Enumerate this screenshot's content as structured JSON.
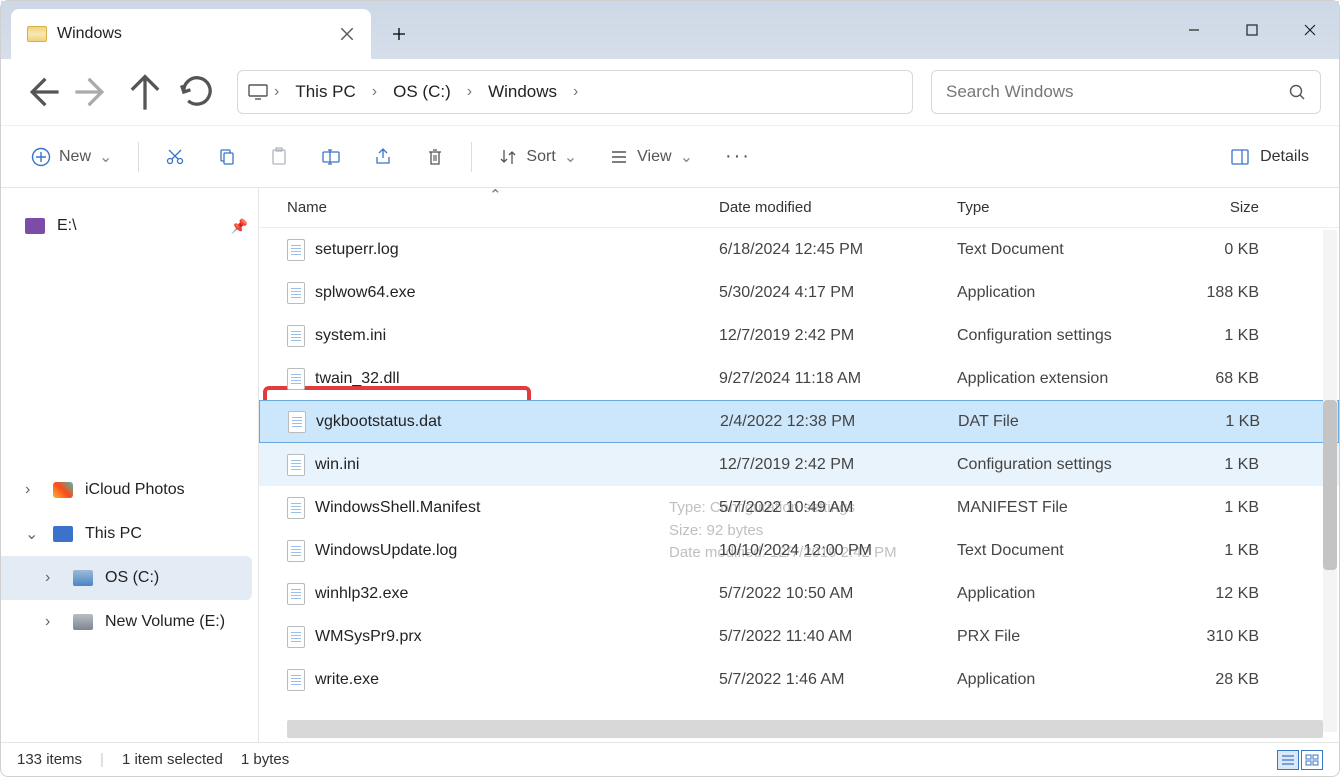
{
  "window": {
    "tab_title": "Windows"
  },
  "breadcrumb": {
    "root": "This PC",
    "seg1": "OS (C:)",
    "seg2": "Windows"
  },
  "search": {
    "placeholder": "Search Windows"
  },
  "toolbar": {
    "new_label": "New",
    "sort_label": "Sort",
    "view_label": "View",
    "details_label": "Details"
  },
  "columns": {
    "name": "Name",
    "modified": "Date modified",
    "type": "Type",
    "size": "Size"
  },
  "sidebar": {
    "item0": "E:\\",
    "item1": "iCloud Photos",
    "item2": "This PC",
    "item3": "OS (C:)",
    "item4": "New Volume (E:)"
  },
  "files": [
    {
      "name": "setuperr.log",
      "date": "6/18/2024 12:45 PM",
      "type": "Text Document",
      "size": "0 KB"
    },
    {
      "name": "splwow64.exe",
      "date": "5/30/2024 4:17 PM",
      "type": "Application",
      "size": "188 KB"
    },
    {
      "name": "system.ini",
      "date": "12/7/2019 2:42 PM",
      "type": "Configuration settings",
      "size": "1 KB"
    },
    {
      "name": "twain_32.dll",
      "date": "9/27/2024 11:18 AM",
      "type": "Application extension",
      "size": "68 KB"
    },
    {
      "name": "vgkbootstatus.dat",
      "date": "2/4/2022 12:38 PM",
      "type": "DAT File",
      "size": "1 KB"
    },
    {
      "name": "win.ini",
      "date": "12/7/2019 2:42 PM",
      "type": "Configuration settings",
      "size": "1 KB"
    },
    {
      "name": "WindowsShell.Manifest",
      "date": "5/7/2022 10:49 AM",
      "type": "MANIFEST File",
      "size": "1 KB"
    },
    {
      "name": "WindowsUpdate.log",
      "date": "10/10/2024 12:00 PM",
      "type": "Text Document",
      "size": "1 KB"
    },
    {
      "name": "winhlp32.exe",
      "date": "5/7/2022 10:50 AM",
      "type": "Application",
      "size": "12 KB"
    },
    {
      "name": "WMSysPr9.prx",
      "date": "5/7/2022 11:40 AM",
      "type": "PRX File",
      "size": "310 KB"
    },
    {
      "name": "write.exe",
      "date": "5/7/2022 1:46 AM",
      "type": "Application",
      "size": "28 KB"
    }
  ],
  "selected_index": 4,
  "hover_index": 5,
  "tooltip": {
    "line1": "Type: Configuration settings",
    "line2": "Size: 92 bytes",
    "line3": "Date modified: 12/7/2019 2:42 PM"
  },
  "status": {
    "count": "133 items",
    "selection": "1 item selected",
    "size": "1 bytes"
  }
}
